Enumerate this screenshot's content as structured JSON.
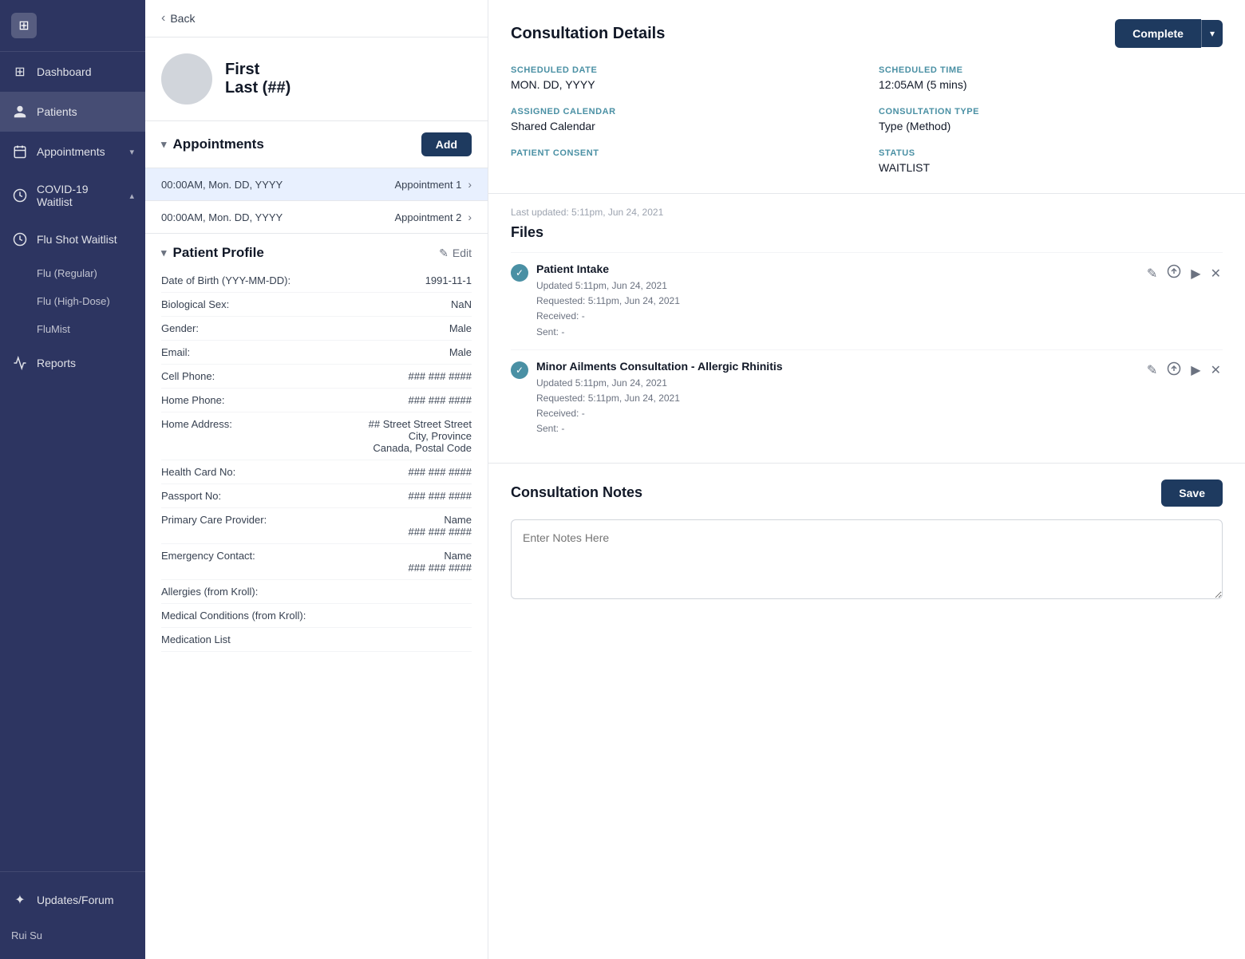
{
  "sidebar": {
    "logo_label": "App",
    "nav_items": [
      {
        "id": "dashboard",
        "label": "Dashboard",
        "icon": "⊞",
        "active": false
      },
      {
        "id": "patients",
        "label": "Patients",
        "icon": "👤",
        "active": true
      },
      {
        "id": "appointments",
        "label": "Appointments",
        "icon": "📅",
        "active": false,
        "has_chevron": true
      },
      {
        "id": "covid-waitlist",
        "label": "COVID-19 Waitlist",
        "icon": "🕐",
        "active": false,
        "has_chevron": true,
        "expanded": true
      },
      {
        "id": "flu-shot-waitlist",
        "label": "Flu Shot Waitlist",
        "icon": "🕐",
        "active": false,
        "expanded": true
      },
      {
        "id": "reports",
        "label": "Reports",
        "icon": "📈",
        "active": false
      }
    ],
    "sub_items": [
      {
        "id": "flu-regular",
        "label": "Flu (Regular)"
      },
      {
        "id": "flu-high-dose",
        "label": "Flu (High-Dose)"
      },
      {
        "id": "flumist",
        "label": "FluMist"
      }
    ],
    "bottom_items": [
      {
        "id": "updates-forum",
        "label": "Updates/Forum",
        "icon": "✦"
      }
    ],
    "user_name": "Rui Su"
  },
  "back_label": "Back",
  "patient": {
    "first_name": "First",
    "last_name": "Last (##)",
    "avatar_alt": "Patient Avatar"
  },
  "appointments_section": {
    "title": "Appointments",
    "add_label": "Add",
    "items": [
      {
        "datetime": "00:00AM, Mon. DD, YYYY",
        "label": "Appointment 1",
        "selected": true
      },
      {
        "datetime": "00:00AM, Mon. DD, YYYY",
        "label": "Appointment 2",
        "selected": false
      }
    ]
  },
  "patient_profile": {
    "title": "Patient Profile",
    "edit_label": "Edit",
    "fields": [
      {
        "label": "Date of Birth (YYY-MM-DD):",
        "value": "1991-11-1"
      },
      {
        "label": "Biological Sex:",
        "value": "NaN"
      },
      {
        "label": "Gender:",
        "value": "Male"
      },
      {
        "label": "Email:",
        "value": "Male"
      },
      {
        "label": "Cell Phone:",
        "value": "### ### ####"
      },
      {
        "label": "Home Phone:",
        "value": "### ### ####"
      },
      {
        "label": "Home Address:",
        "value": "## Street Street Street\nCity, Province\nCanada, Postal Code"
      },
      {
        "label": "Health Card No:",
        "value": "### ### ####"
      },
      {
        "label": "Passport No:",
        "value": "### ### ####"
      },
      {
        "label": "Primary Care Provider:",
        "value": "Name\n### ### ####"
      },
      {
        "label": "Emergency Contact:",
        "value": "Name\n### ### ####"
      },
      {
        "label": "Allergies (from Kroll):",
        "value": ""
      },
      {
        "label": "Medical Conditions (from Kroll):",
        "value": ""
      },
      {
        "label": "Medication List",
        "value": ""
      }
    ]
  },
  "consultation_details": {
    "title": "Consultation Details",
    "complete_label": "Complete",
    "dropdown_icon": "▾",
    "fields": [
      {
        "id": "scheduled_date",
        "label": "SCHEDULED DATE",
        "value": "MON. DD, YYYY"
      },
      {
        "id": "scheduled_time",
        "label": "SCHEDULED TIME",
        "value": "12:05AM (5 mins)"
      },
      {
        "id": "assigned_calendar",
        "label": "ASSIGNED CALENDAR",
        "value": "Shared Calendar"
      },
      {
        "id": "consultation_type",
        "label": "CONSULTATION TYPE",
        "value": "Type (Method)"
      },
      {
        "id": "patient_consent",
        "label": "PATIENT CONSENT",
        "value": ""
      },
      {
        "id": "status",
        "label": "STATUS",
        "value": "WAITLIST"
      }
    ]
  },
  "files_section": {
    "last_updated": "Last updated: 5:11pm, Jun 24, 2021",
    "title": "Files",
    "items": [
      {
        "name": "Patient Intake",
        "updated": "Updated 5:11pm, Jun 24, 2021",
        "requested": "Requested: 5:11pm, Jun 24, 2021",
        "received": "Received: -",
        "sent": "Sent: -"
      },
      {
        "name": "Minor Ailments Consultation - Allergic Rhinitis",
        "updated": "Updated 5:11pm, Jun 24, 2021",
        "requested": "Requested: 5:11pm, Jun 24, 2021",
        "received": "Received: -",
        "sent": "Sent: -"
      }
    ],
    "action_icons": {
      "edit": "✎",
      "upload": "⬆",
      "send": "▶",
      "delete": "✕"
    }
  },
  "consultation_notes": {
    "title": "Consultation Notes",
    "save_label": "Save",
    "placeholder": "Enter Notes Here"
  }
}
